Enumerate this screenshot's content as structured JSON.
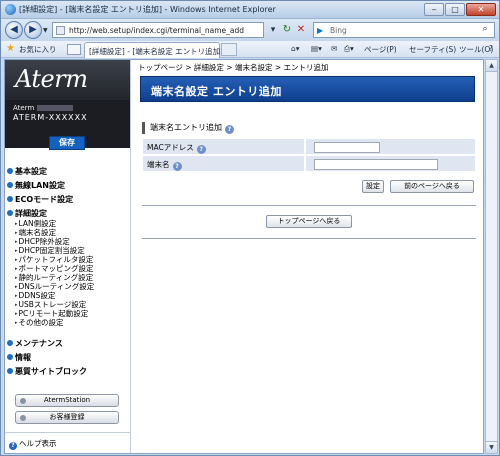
{
  "window": {
    "title": "[詳細設定] - [端末名設定 エントリ追加] - Windows Internet Explorer",
    "minimize": "‒",
    "maximize": "□",
    "close": "✕"
  },
  "addressbar": {
    "url": "http://web.setup/index.cgi/terminal_name_add",
    "search_placeholder": "Bing"
  },
  "favbar": {
    "favorites_label": "お気に入り",
    "tab_label": "[詳細設定] - [端末名設定 エントリ追加]",
    "commands": {
      "page": "ページ(P)",
      "safety": "セーフティ(S)",
      "tools": "ツール(O)",
      "help": "?"
    }
  },
  "sidebar": {
    "logo": "Aterm",
    "model_prefix": "Aterm",
    "model_id": "ATERM-XXXXXX",
    "save_label": "保存",
    "menu": {
      "basic": "基本設定",
      "wireless": "無線LAN設定",
      "eco": "ECOモード設定",
      "detail": "詳細設定",
      "detail_items": [
        "LAN側設定",
        "端末名設定",
        "DHCP除外設定",
        "DHCP固定割当設定",
        "パケットフィルタ設定",
        "ポートマッピング設定",
        "静的ルーティング設定",
        "DNSルーティング設定",
        "DDNS設定",
        "USBストレージ設定",
        "PCリモート起動設定",
        "その他の設定"
      ],
      "maintenance": "メンテナンス",
      "info": "情報",
      "malicious": "悪質サイトブロック"
    },
    "aterm_station_label": "AtermStation",
    "register_label": "お客様登録",
    "help_label": "ヘルプ表示"
  },
  "main": {
    "breadcrumb": "トップページ > 詳細設定 > 端末名設定 > エントリ追加",
    "page_title": "端末名設定 エントリ追加",
    "section_title": "端末名エントリ追加",
    "form": {
      "mac_label": "MACアドレス",
      "mac_value": "",
      "name_label": "端末名",
      "name_value": ""
    },
    "set_button": "設定",
    "back_button": "前のページへ戻る",
    "top_button": "トップページへ戻る"
  }
}
